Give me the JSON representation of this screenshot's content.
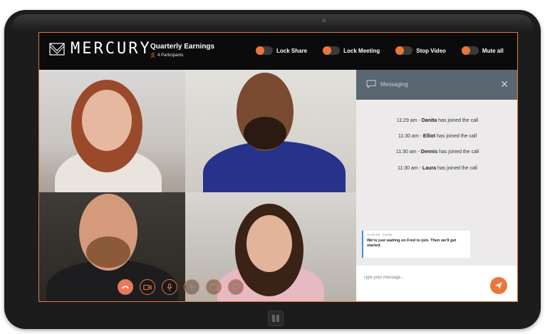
{
  "app": {
    "name": "MERCURY"
  },
  "meeting": {
    "title": "Quarterly Earnings",
    "participants": "4 Participants"
  },
  "controls": [
    {
      "label": "Lock Share"
    },
    {
      "label": "Lock Meeting"
    },
    {
      "label": "Stop Video"
    },
    {
      "label": "Mute all"
    }
  ],
  "call_bar": {
    "icons": [
      "hang-up-icon",
      "video-camera-icon",
      "microphone-icon",
      "add-icon",
      "screen-share-icon",
      "chat-icon"
    ]
  },
  "messaging": {
    "title": "Messaging",
    "system_messages": [
      {
        "time": "11:29 am",
        "name": "Danita",
        "text": "has joined the call"
      },
      {
        "time": "11:30 am",
        "name": "Elliot",
        "text": "has joined the call"
      },
      {
        "time": "11:30 am",
        "name": "Dennis",
        "text": "has joined the call"
      },
      {
        "time": "11:30 am",
        "name": "Laura",
        "text": "has joined the call"
      }
    ],
    "chat": {
      "time": "11:30 am",
      "sender": "Danita",
      "text": "We're just waiting on Fred to join. Then we'll get started."
    },
    "compose_placeholder": "Type your message..."
  },
  "colors": {
    "accent": "#e8783a",
    "panel_header": "#5a6670",
    "topbar": "#0b0b0c"
  }
}
